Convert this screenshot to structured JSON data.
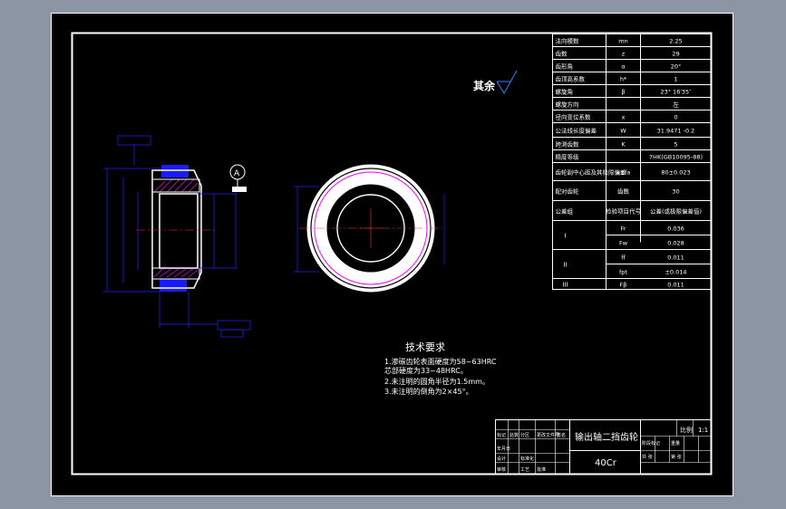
{
  "params": [
    {
      "name": "法向模数",
      "sym": "mn",
      "val": "2.25"
    },
    {
      "name": "齿数",
      "sym": "z",
      "val": "29"
    },
    {
      "name": "齿形角",
      "sym": "α",
      "val": "20°"
    },
    {
      "name": "齿顶高系数",
      "sym": "h*",
      "val": "1"
    },
    {
      "name": "螺旋角",
      "sym": "β",
      "val": "23° 16′35″"
    },
    {
      "name": "螺旋方向",
      "sym": "",
      "val": "左"
    },
    {
      "name": "径向变位系数",
      "sym": "x",
      "val": "0"
    },
    {
      "name": "公法线长度偏差",
      "sym": "W",
      "val": "31.9471 -0.2"
    },
    {
      "name": "跨测齿数",
      "sym": "K",
      "val": "5"
    },
    {
      "name": "精度等级",
      "sym": "",
      "val": "7HK(GB10095-88)"
    },
    {
      "name": "齿轮副中心距及其极限偏差",
      "sym": "a±fa",
      "val": "80±0.023"
    },
    {
      "name": "配对齿轮",
      "sym": "齿数",
      "val": "30"
    },
    {
      "name": "公差组",
      "sym": "检验项目代号",
      "val": "公差(或极限偏差值)"
    }
  ],
  "tol_groups": [
    {
      "grp": "I",
      "rows": [
        {
          "sym": "Fr",
          "val": "0.036"
        },
        {
          "sym": "Fw",
          "val": "0.028"
        }
      ]
    },
    {
      "grp": "II",
      "rows": [
        {
          "sym": "ff",
          "val": "0.011"
        },
        {
          "sym": "fpt",
          "val": "±0.014"
        }
      ]
    },
    {
      "grp": "III",
      "rows": [
        {
          "sym": "Fβ",
          "val": "0.011"
        }
      ]
    }
  ],
  "roughness_note": "其余",
  "tech": {
    "title": "技术要求",
    "lines": [
      "1.渗碳齿轮表面硬度为58~63HRC",
      "芯部硬度为33~48HRC。",
      "2.未注明的圆角半径为1.5mm。",
      "3.未注明的倒角为2×45°。"
    ]
  },
  "title_block": {
    "name": "输出轴二挡齿轮",
    "material": "40Cr",
    "scale": "1:1",
    "scale_label": "比例",
    "cells": [
      "标记",
      "处数",
      "分区",
      "更改文件号",
      "签名",
      "年月日",
      "设计",
      "标准化",
      "审核",
      "工艺",
      "批准",
      "阶段标记",
      "重量",
      "共 张",
      "第 张"
    ]
  },
  "datum_label": "A",
  "colors": {
    "sheet": "#000000",
    "frame": "#ffffff",
    "dim": "#2323ff",
    "part": "#ffffff",
    "center": "#ff3030",
    "hatch": "#ff00ff"
  }
}
